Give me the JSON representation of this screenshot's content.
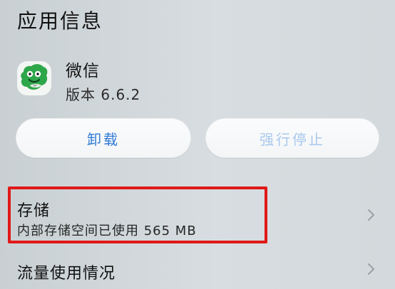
{
  "header": {
    "title": "应用信息"
  },
  "app": {
    "name": "微信",
    "version": "版本 6.6.2",
    "icon": "wechat-app-icon"
  },
  "actions": {
    "uninstall": "卸载",
    "force_stop": "强行停止"
  },
  "storage": {
    "title": "存储",
    "subtitle": "内部存储空间已使用 565 MB",
    "chevron_icon": "chevron-right-icon"
  },
  "traffic": {
    "title": "流量使用情况",
    "chevron_icon": "chevron-right-icon"
  },
  "colors": {
    "accent": "#2f7ad8",
    "disabled_button_text": "#a9c8ee",
    "highlight": "#e01818"
  }
}
